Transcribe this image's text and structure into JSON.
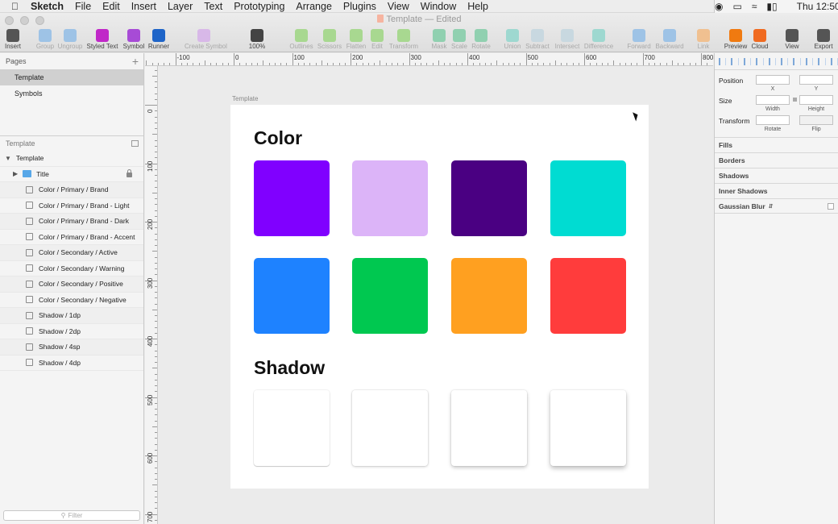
{
  "menubar": {
    "app": "Sketch",
    "items": [
      "File",
      "Edit",
      "Insert",
      "Layer",
      "Text",
      "Prototyping",
      "Arrange",
      "Plugins",
      "View",
      "Window",
      "Help"
    ],
    "clock": "Thu 12:50"
  },
  "window": {
    "title": "Template — Edited"
  },
  "toolbar": {
    "items": [
      {
        "label": "Insert",
        "icon": "plus-icon",
        "color": "#555555",
        "enabled": true
      },
      {
        "label": "Group",
        "icon": "group-icon",
        "color": "#9ec3e6",
        "enabled": false
      },
      {
        "label": "Ungroup",
        "icon": "ungroup-icon",
        "color": "#9ec3e6",
        "enabled": false
      },
      {
        "label": "Styled Text",
        "icon": "styled-text-icon",
        "color": "#c027c8",
        "enabled": true
      },
      {
        "label": "Symbol",
        "icon": "symbol-icon",
        "color": "#a74bd6",
        "enabled": true
      },
      {
        "label": "Runner",
        "icon": "runner-icon",
        "color": "#1e64c8",
        "enabled": true
      },
      {
        "label": "Create Symbol",
        "icon": "create-symbol-icon",
        "color": "#d8b8e8",
        "enabled": false
      },
      {
        "label": "100%",
        "icon": "zoom-icon",
        "color": "#444444",
        "enabled": true
      },
      {
        "label": "Outlines",
        "icon": "outlines-icon",
        "color": "#a8d890",
        "enabled": false
      },
      {
        "label": "Scissors",
        "icon": "scissors-icon",
        "color": "#a8d890",
        "enabled": false
      },
      {
        "label": "Flatten",
        "icon": "flatten-icon",
        "color": "#a8d890",
        "enabled": false
      },
      {
        "label": "Edit",
        "icon": "edit-icon",
        "color": "#a8d890",
        "enabled": false
      },
      {
        "label": "Transform",
        "icon": "transform-icon",
        "color": "#a8d890",
        "enabled": false
      },
      {
        "label": "Mask",
        "icon": "mask-icon",
        "color": "#90d0b0",
        "enabled": false
      },
      {
        "label": "Scale",
        "icon": "scale-icon",
        "color": "#90d0b0",
        "enabled": false
      },
      {
        "label": "Rotate",
        "icon": "rotate-icon",
        "color": "#90d0b0",
        "enabled": false
      },
      {
        "label": "Union",
        "icon": "union-icon",
        "color": "#9ed8d0",
        "enabled": false
      },
      {
        "label": "Subtract",
        "icon": "subtract-icon",
        "color": "#c8d8e0",
        "enabled": false
      },
      {
        "label": "Intersect",
        "icon": "intersect-icon",
        "color": "#c8d8e0",
        "enabled": false
      },
      {
        "label": "Difference",
        "icon": "difference-icon",
        "color": "#9ed8d0",
        "enabled": false
      },
      {
        "label": "Forward",
        "icon": "forward-icon",
        "color": "#9ec3e6",
        "enabled": false
      },
      {
        "label": "Backward",
        "icon": "backward-icon",
        "color": "#9ec3e6",
        "enabled": false
      },
      {
        "label": "Link",
        "icon": "link-icon",
        "color": "#f0c090",
        "enabled": false
      },
      {
        "label": "Preview",
        "icon": "preview-icon",
        "color": "#f07a10",
        "enabled": true
      },
      {
        "label": "Cloud",
        "icon": "cloud-icon",
        "color": "#f06a20",
        "enabled": true
      },
      {
        "label": "View",
        "icon": "view-icon",
        "color": "#555555",
        "enabled": true
      },
      {
        "label": "Export",
        "icon": "export-icon",
        "color": "#555555",
        "enabled": true
      }
    ]
  },
  "pages": {
    "title": "Pages",
    "items": [
      {
        "label": "Template",
        "selected": true
      },
      {
        "label": "Symbols",
        "selected": false
      }
    ]
  },
  "layers": {
    "title": "Template",
    "group": "Template",
    "items": [
      {
        "label": "Title",
        "type": "folder",
        "locked": true
      },
      {
        "label": "Color / Primary / Brand",
        "type": "symbol"
      },
      {
        "label": "Color / Primary / Brand - Light",
        "type": "symbol"
      },
      {
        "label": "Color / Primary / Brand - Dark",
        "type": "symbol"
      },
      {
        "label": "Color / Primary / Brand - Accent",
        "type": "symbol"
      },
      {
        "label": "Color / Secondary / Active",
        "type": "symbol"
      },
      {
        "label": "Color / Secondary / Warning",
        "type": "symbol"
      },
      {
        "label": "Color / Secondary / Positive",
        "type": "symbol"
      },
      {
        "label": "Color / Secondary / Negative",
        "type": "symbol"
      },
      {
        "label": "Shadow / 1dp",
        "type": "symbol"
      },
      {
        "label": "Shadow / 2dp",
        "type": "symbol"
      },
      {
        "label": "Shadow / 4sp",
        "type": "symbol"
      },
      {
        "label": "Shadow / 4dp",
        "type": "symbol"
      }
    ],
    "filter_placeholder": "Filter"
  },
  "rulers": {
    "top": [
      "-100",
      "0",
      "100",
      "200",
      "300",
      "400",
      "500",
      "600",
      "700",
      "800"
    ],
    "left": [
      "0",
      "100",
      "200",
      "300",
      "400",
      "500",
      "600",
      "700"
    ]
  },
  "artboard": {
    "name": "Template",
    "color_heading": "Color",
    "shadow_heading": "Shadow",
    "colors": [
      "#8000ff",
      "#dcb4f8",
      "#4a0082",
      "#00dcd2",
      "#1e82ff",
      "#00c850",
      "#ffa020",
      "#ff3c3c"
    ],
    "shadows": [
      "1dp",
      "2dp",
      "4sp",
      "4dp"
    ]
  },
  "inspector": {
    "position": "Position",
    "x": "X",
    "y": "Y",
    "size": "Size",
    "width": "Width",
    "height": "Height",
    "transform": "Transform",
    "rotate": "Rotate",
    "flip": "Flip",
    "sections": [
      "Fills",
      "Borders",
      "Shadows",
      "Inner Shadows",
      "Gaussian Blur"
    ]
  }
}
